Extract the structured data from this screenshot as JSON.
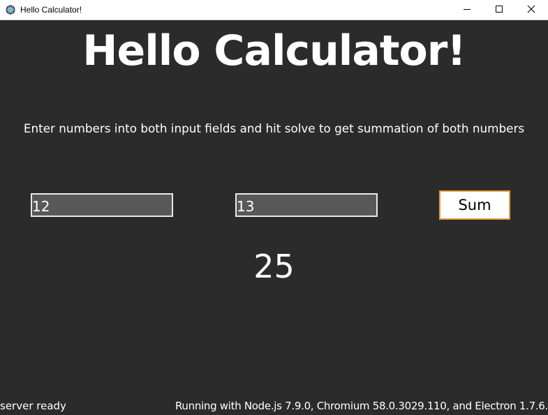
{
  "window": {
    "title": "Hello Calculator!",
    "icon": "electron-atom-icon",
    "controls": [
      "minimize-icon",
      "maximize-icon",
      "close-icon"
    ]
  },
  "main": {
    "heading": "Hello Calculator!",
    "instructions": "Enter numbers into both input fields and hit solve to get summation of both numbers",
    "input_a": {
      "value": "12"
    },
    "input_b": {
      "value": "13"
    },
    "sum_button_label": "Sum",
    "result": "25"
  },
  "status": {
    "left": "server ready",
    "right": "Running with Node.js 7.9.0, Chromium 58.0.3029.110, and Electron 1.7.6."
  },
  "colors": {
    "background": "#2b2b2b",
    "text": "#ffffff",
    "input_background": "#585858",
    "button_border": "#e8a040"
  }
}
